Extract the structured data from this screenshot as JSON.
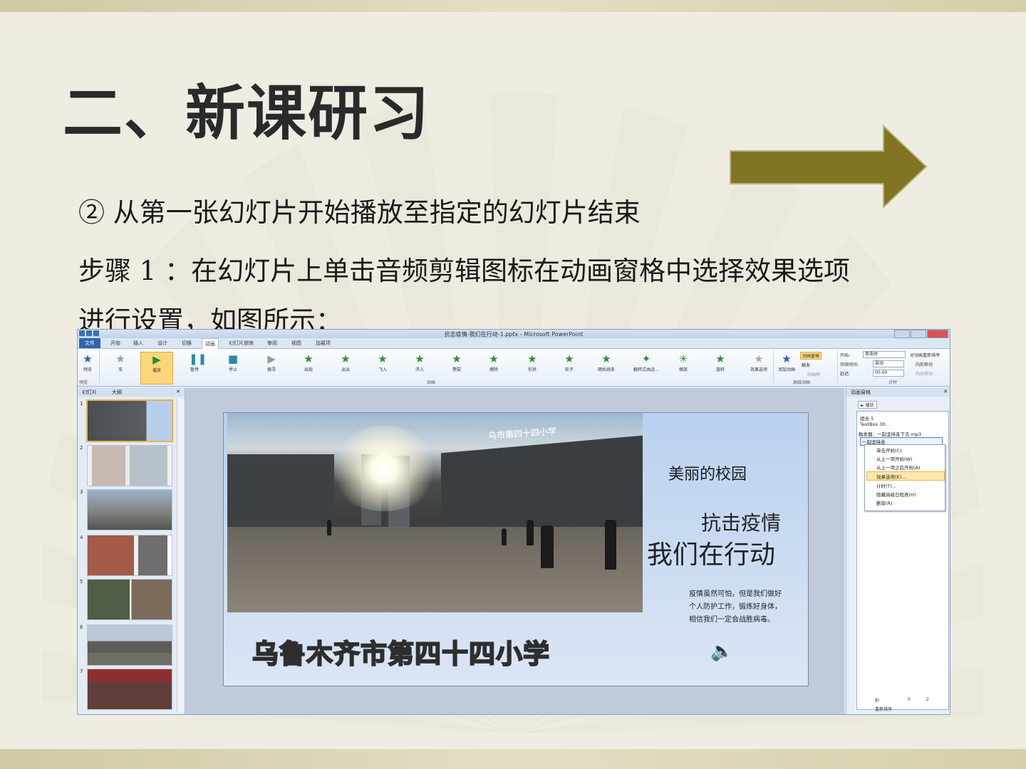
{
  "slide": {
    "title": "二、新课研习",
    "line1": "②  从第一张幻灯片开始播放至指定的幻灯片结束",
    "line2": "步骤 1 ：在幻灯片上单击音频剪辑图标在动画窗格中选择效果选项",
    "line3": "进行设置，如图所示：",
    "arrow_color": "#7f7522"
  },
  "app": {
    "window_title": "抗击疫情-我们在行动-1.pptx - Microsoft PowerPoint",
    "menu": [
      "文件",
      "开始",
      "插入",
      "设计",
      "切换",
      "动画",
      "幻灯片放映",
      "审阅",
      "视图",
      "加载项"
    ],
    "active_menu": "动画",
    "ribbon": {
      "preview": "预览",
      "effects": [
        "无",
        "播放",
        "暂停",
        "停止",
        "搜寻",
        "出现",
        "淡出",
        "飞入",
        "浮入",
        "劈裂",
        "擦除",
        "形状",
        "轮子",
        "随机线条",
        "翻转式由远...",
        "缩放",
        "旋转"
      ],
      "effect_options": "效果选项",
      "group_preview": "预览",
      "group_animation": "动画",
      "add_animation": "添加动画",
      "animation_pane": "动画窗格",
      "trigger": "触发",
      "painter": "动画刷",
      "group_advanced": "高级动画",
      "start_label": "开始:",
      "start_value": "单击时",
      "duration_label": "持续时间:",
      "duration_value": "自动",
      "delay_label": "延迟:",
      "delay_value": "00.00",
      "reorder_title": "对动画重新排序",
      "move_earlier": "向前移动",
      "move_later": "向后移动",
      "group_timing": "计时"
    },
    "left_tabs": [
      "幻灯片",
      "大纲"
    ],
    "slide_numbers": [
      "1",
      "2",
      "3",
      "4",
      "5",
      "6",
      "7"
    ],
    "canvas": {
      "photo_sign": "乌市第四十四小学",
      "subtitle": "美丽的校园",
      "headline1": "抗击疫情",
      "headline2": "我们在行动",
      "paragraph": "疫情虽然可怕，但是我们做好个人防护工作，锻炼好身体，相信我们一定会战胜病毒。",
      "school": "乌鲁木齐市第四十四小学"
    },
    "ani_pane": {
      "title": "动画窗格",
      "play": "播放",
      "items": [
        "组合 5",
        "TextBox 30..."
      ],
      "trigger_row": "触发器：一起坚持走下去.mp3",
      "selected": "一起坚持走",
      "menu": [
        "单击开始(C)",
        "从上一项开始(W)",
        "从上一项之后开始(A)",
        "效果选项(E)...",
        "计时(T)...",
        "隐藏高级日程表(H)",
        "删除(R)"
      ],
      "seconds": "秒",
      "reorder": "重新排序",
      "zoom_from": "0",
      "zoom_to": "2"
    }
  }
}
